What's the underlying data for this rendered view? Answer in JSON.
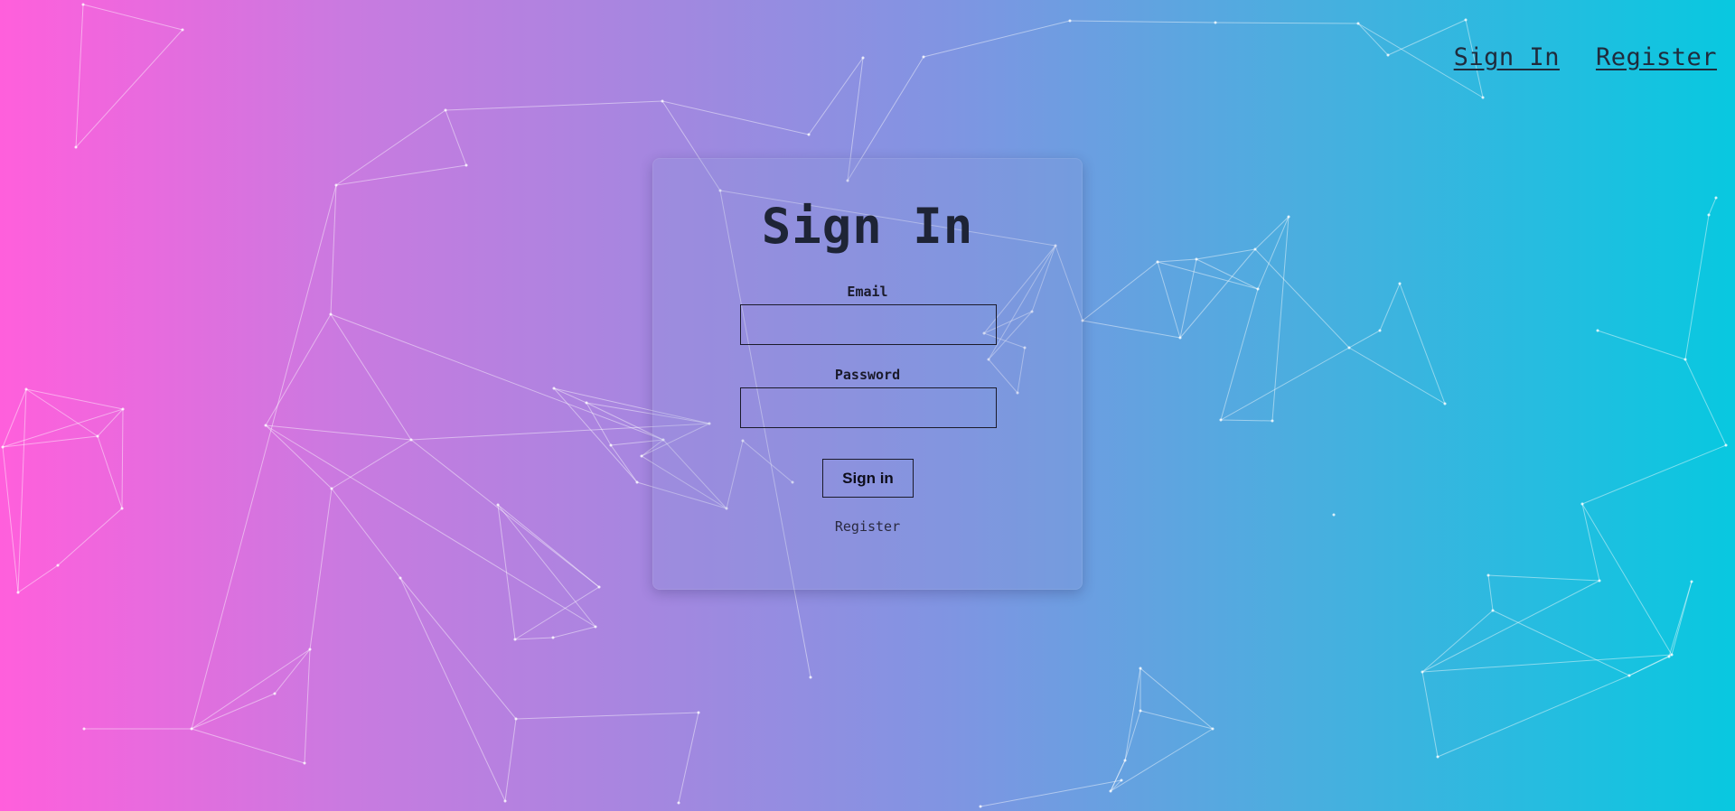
{
  "nav": {
    "sign_in": "Sign In",
    "register": "Register"
  },
  "form": {
    "title": "Sign In",
    "email_label": "Email",
    "email_value": "",
    "password_label": "Password",
    "password_value": "",
    "submit_label": "Sign in",
    "register_link": "Register"
  },
  "colors": {
    "gradient_left": "#ff5fdc",
    "gradient_right": "#08c8e0",
    "text_dark": "#1e2436"
  }
}
